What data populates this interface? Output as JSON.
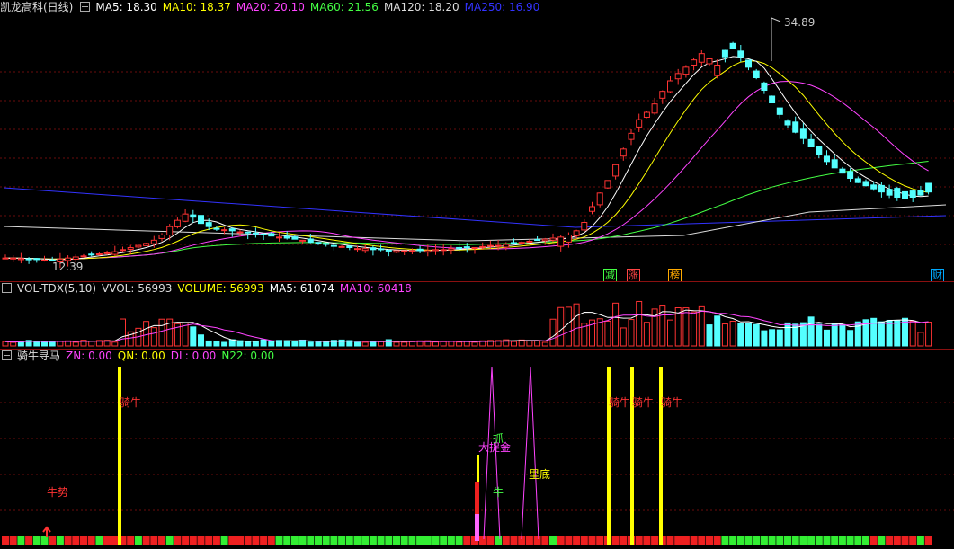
{
  "price_header": {
    "title": "凯龙高科(日线)",
    "ma": [
      {
        "label": "MA5: 18.30",
        "color": "#ffffff"
      },
      {
        "label": "MA10: 18.37",
        "color": "#ffff00"
      },
      {
        "label": "MA20: 20.10",
        "color": "#ff44ff"
      },
      {
        "label": "MA60: 21.56",
        "color": "#44ff44"
      },
      {
        "label": "MA120: 18.20",
        "color": "#dddddd"
      },
      {
        "label": "MA250: 16.90",
        "color": "#3333ff"
      }
    ]
  },
  "price_marks": {
    "high": "34.89",
    "low": "12.39"
  },
  "tags": [
    {
      "text": "减",
      "color": "#44ff44"
    },
    {
      "text": "涨",
      "color": "#ff4444"
    },
    {
      "text": "榜",
      "color": "#ffaa00"
    },
    {
      "text": "财",
      "color": "#00aaff"
    }
  ],
  "vol_header": {
    "title": "VOL-TDX(5,10)",
    "items": [
      {
        "label": "VVOL: 56993",
        "color": "#dddddd"
      },
      {
        "label": "VOLUME: 56993",
        "color": "#ffff00"
      },
      {
        "label": "MA5: 61074",
        "color": "#ffffff"
      },
      {
        "label": "MA10: 60418",
        "color": "#ff44ff"
      }
    ]
  },
  "ind_header": {
    "title": "骑牛寻马",
    "items": [
      {
        "label": "ZN: 0.00",
        "color": "#ff44ff"
      },
      {
        "label": "QN: 0.00",
        "color": "#ffff00"
      },
      {
        "label": "DL: 0.00",
        "color": "#ff44ff"
      },
      {
        "label": "N22: 0.00",
        "color": "#44ff44"
      }
    ]
  },
  "ind_labels": {
    "qiniu": "骑牛",
    "niushi": "牛势",
    "dazhuajin": "大捉金",
    "zhua": "抓",
    "niu": "牛",
    "lidi": "里底"
  },
  "chart_data": {
    "type": "candlestick",
    "closes": [
      12.6,
      12.6,
      12.55,
      12.5,
      12.45,
      12.4,
      12.39,
      12.5,
      12.6,
      12.7,
      12.8,
      12.9,
      13.0,
      13.1,
      13.2,
      13.4,
      13.6,
      13.8,
      14.0,
      14.3,
      14.8,
      15.6,
      16.2,
      16.8,
      16.5,
      15.9,
      15.6,
      15.4,
      15.3,
      15.2,
      15.1,
      15.0,
      14.9,
      14.8,
      14.7,
      14.6,
      14.5,
      14.4,
      14.3,
      14.1,
      14.0,
      13.9,
      13.8,
      13.7,
      13.6,
      13.5,
      13.5,
      13.4,
      13.4,
      13.3,
      13.3,
      13.3,
      13.3,
      13.3,
      13.3,
      13.4,
      13.4,
      13.5,
      13.5,
      13.6,
      13.6,
      13.7,
      13.8,
      13.8,
      13.9,
      14.0,
      14.1,
      14.2,
      14.3,
      14.4,
      14.5,
      14.6,
      14.8,
      15.2,
      16.0,
      17.5,
      18.8,
      20.0,
      21.5,
      23.0,
      24.5,
      25.8,
      26.5,
      27.3,
      28.5,
      29.5,
      30.2,
      30.8,
      31.5,
      32.1,
      31.6,
      31.0,
      31.8,
      32.6,
      31.8,
      30.8,
      29.8,
      28.6,
      27.4,
      26.3,
      25.3,
      24.6,
      24.0,
      23.2,
      22.5,
      21.8,
      21.2,
      20.7,
      20.2,
      19.8,
      19.5,
      19.2,
      18.9,
      18.6,
      18.4,
      18.3,
      18.4,
      18.6,
      18.9
    ],
    "volume_ma5": 61074,
    "volume_ma10": 60418,
    "last_volume": 56993
  }
}
